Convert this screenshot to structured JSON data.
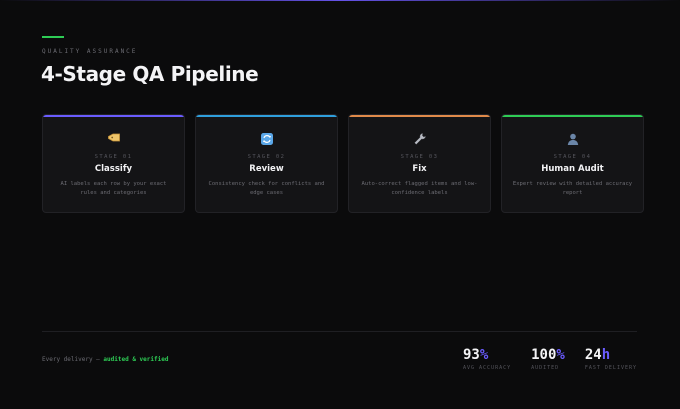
{
  "header": {
    "eyebrow": "QUALITY ASSURANCE",
    "title": "4-Stage QA Pipeline"
  },
  "colors": {
    "accent_green": "#2ecc55",
    "accent_purple": "#6a5cff",
    "stage_1": "#6a5cff",
    "stage_2": "#2f9fdc",
    "stage_3": "#e08a4a",
    "stage_4": "#2ecc55"
  },
  "stages": [
    {
      "icon": "tag-icon",
      "stage": "STAGE 01",
      "title": "Classify",
      "desc": "AI labels each row by your exact rules and categories"
    },
    {
      "icon": "refresh-icon",
      "stage": "STAGE 02",
      "title": "Review",
      "desc": "Consistency check for conflicts and edge cases"
    },
    {
      "icon": "wrench-icon",
      "stage": "STAGE 03",
      "title": "Fix",
      "desc": "Auto-correct flagged items and low-confidence labels"
    },
    {
      "icon": "person-icon",
      "stage": "STAGE 04",
      "title": "Human Audit",
      "desc": "Expert review with detailed accuracy report"
    }
  ],
  "footer": {
    "prefix": "Every delivery — ",
    "highlight": "audited & verified"
  },
  "stats": [
    {
      "value": "93",
      "unit": "%",
      "label": "AVG ACCURACY"
    },
    {
      "value": "100",
      "unit": "%",
      "label": "AUDITED"
    },
    {
      "value": "24",
      "unit": "h",
      "label": "FAST DELIVERY"
    }
  ]
}
